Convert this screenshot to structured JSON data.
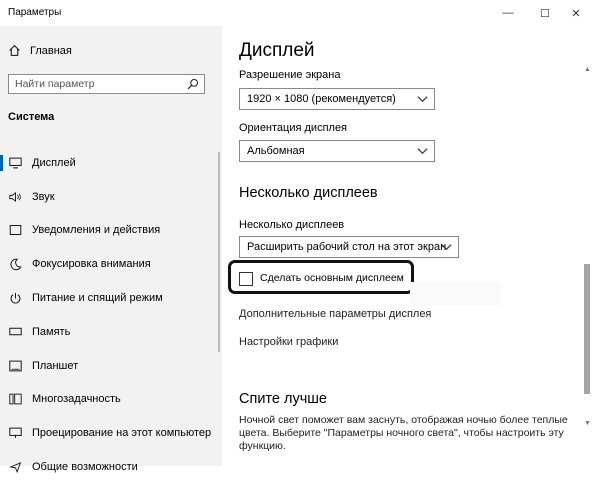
{
  "window": {
    "title": "Параметры",
    "min_glyph": "—",
    "max_glyph": "☐",
    "close_glyph": "✕"
  },
  "sidebar": {
    "home_label": "Главная",
    "search_placeholder": "Найти параметр",
    "section_title": "Система",
    "items": [
      {
        "label": "Дисплей",
        "icon": "monitor-icon"
      },
      {
        "label": "Звук",
        "icon": "speaker-icon"
      },
      {
        "label": "Уведомления и действия",
        "icon": "notification-icon"
      },
      {
        "label": "Фокусировка внимания",
        "icon": "moon-icon"
      },
      {
        "label": "Питание и спящий режим",
        "icon": "power-icon"
      },
      {
        "label": "Память",
        "icon": "storage-icon"
      },
      {
        "label": "Планшет",
        "icon": "tablet-icon"
      },
      {
        "label": "Многозадачность",
        "icon": "multitasking-icon"
      },
      {
        "label": "Проецирование на этот компьютер",
        "icon": "projection-icon"
      },
      {
        "label": "Общие возможности",
        "icon": "shared-icon"
      }
    ]
  },
  "main": {
    "title": "Дисплей",
    "resolution_label": "Разрешение экрана",
    "resolution_value": "1920 × 1080 (рекомендуется)",
    "orientation_label": "Ориентация дисплея",
    "orientation_value": "Альбомная",
    "multi_heading": "Несколько дисплеев",
    "multi_label": "Несколько дисплеев",
    "multi_value": "Расширить рабочий стол на этот экран",
    "make_main_label": "Сделать основным дисплеем",
    "make_main_checked": false,
    "advanced_link": "Дополнительные параметры дисплея",
    "graphics_link": "Настройки графики",
    "sleep_heading": "Спите лучше",
    "sleep_desc": "Ночной свет поможет вам заснуть, отображая ночью более теплые цвета. Выберите \"Параметры ночного света\", чтобы настроить эту функцию."
  }
}
